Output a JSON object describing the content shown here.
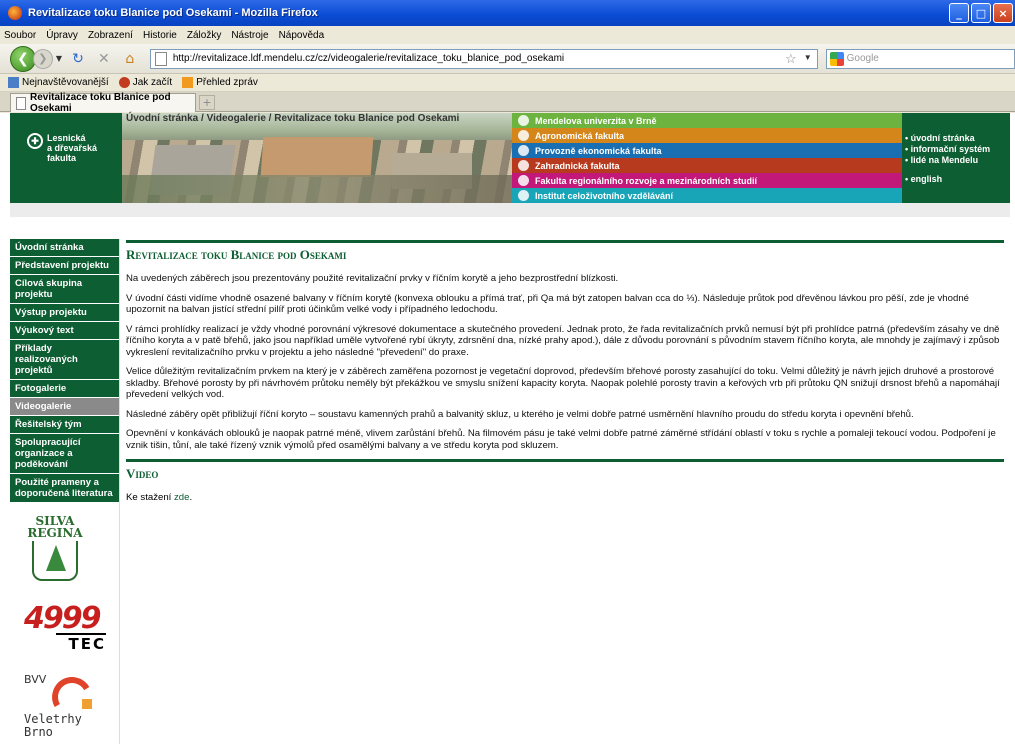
{
  "browser": {
    "title": "Revitalizace toku Blanice pod Osekami - Mozilla Firefox",
    "menu": [
      "Soubor",
      "Úpravy",
      "Zobrazení",
      "Historie",
      "Záložky",
      "Nástroje",
      "Nápověda"
    ],
    "url": "http://revitalizace.ldf.mendelu.cz/cz/videogalerie/revitalizace_toku_blanice_pod_osekami",
    "search_placeholder": "Google",
    "bookmarks": [
      "Nejnavštěvovanější",
      "Jak začít",
      "Přehled zpráv"
    ],
    "tab_label": "Revitalizace toku Blanice pod Osekami",
    "new_tab": "+"
  },
  "header": {
    "logo_lines": [
      "Lesnická",
      "a dřevařská",
      "fakulta"
    ],
    "faculties": [
      {
        "label": "Mendelova univerzita v Brně",
        "color": "#6db33f"
      },
      {
        "label": "Agronomická fakulta",
        "color": "#d4861a"
      },
      {
        "label": "Provozně ekonomická fakulta",
        "color": "#1a6fb3"
      },
      {
        "label": "Zahradnická fakulta",
        "color": "#b83a1e"
      },
      {
        "label": "Fakulta regionálního rozvoje a mezinárodních studií",
        "color": "#c2187a"
      },
      {
        "label": "Institut celoživotního vzdělávání",
        "color": "#19a5b8"
      }
    ],
    "links": [
      "• úvodní stránka",
      "• informační systém",
      "• lidé na Mendelu",
      "• english"
    ]
  },
  "breadcrumb": {
    "home": "Úvodní stránka",
    "sep": " / ",
    "section": "Videogalerie",
    "current": "Revitalizace toku Blanice pod Osekami"
  },
  "sidebar": {
    "items": [
      {
        "label": "Úvodní stránka",
        "active": false
      },
      {
        "label": "Představení projektu",
        "active": false
      },
      {
        "label": "Cílová skupina projektu",
        "active": false
      },
      {
        "label": "Výstup projektu",
        "active": false
      },
      {
        "label": "Výukový text",
        "active": false
      },
      {
        "label": "Příklady realizovaných projektů",
        "active": false
      },
      {
        "label": "Fotogalerie",
        "active": false
      },
      {
        "label": "Videogalerie",
        "active": true
      },
      {
        "label": "Řešitelský tým",
        "active": false
      },
      {
        "label": "Spolupracující organizace a poděkování",
        "active": false
      },
      {
        "label": "Použité prameny a doporučená literatura",
        "active": false
      }
    ],
    "logos": {
      "silva": [
        "SILVA",
        "REGINA"
      ],
      "htec_num": "4999",
      "htec_text": "TEC",
      "bvv_short": "BVV",
      "bvv_lines": [
        "Veletrhy",
        "Brno"
      ]
    }
  },
  "content": {
    "title": "Revitalizace toku Blanice pod Osekami",
    "paragraphs": [
      "Na uvedených záběrech jsou prezentovány použité revitalizační prvky v říčním korytě a jeho bezprostřední blízkosti.",
      "V úvodní části vidíme vhodně osazené balvany v říčním korytě (konvexa oblouku a přímá trať, při Qa má být zatopen balvan cca do ⅓). Následuje průtok pod dřevěnou lávkou pro pěší, zde je vhodné upozornit na balvan jistící střední pilíř proti účinkům velké vody i případného ledochodu.",
      "V rámci prohlídky realizací je vždy vhodné porovnání výkresové dokumentace a skutečného provedení. Jednak proto, že řada revitalizačních prvků nemusí být při prohlídce patrná (především zásahy ve dně říčního koryta a v patě břehů, jako jsou například uměle vytvořené rybí úkryty, zdrsnění dna, nízké prahy apod.), dále z důvodu porovnání s původním stavem říčního koryta, ale mnohdy je zajímavý i způsob vykreslení revitalizačního prvku v projektu a jeho následné \"převedení\" do praxe.",
      "Velice důležitým revitalizačním prvkem na který je v záběrech zaměřena pozornost je vegetační doprovod, především břehové porosty zasahující do toku. Velmi důležitý je návrh jejich druhové a prostorové skladby. Břehové porosty by při návrhovém průtoku neměly být překážkou ve smyslu snížení kapacity koryta. Naopak polehlé porosty travin a keřových vrb při průtoku QN snižují drsnost břehů a napomáhají převedení velkých vod.",
      "Následné záběry opět přibližují říční koryto – soustavu kamenných prahů a balvanitý skluz, u kterého je velmi dobře patrné usměrnění hlavního proudu do středu koryta i opevnění břehů.",
      "Opevnění v konkávách oblouků je naopak patrné méně, vlivem zarůstání břehů. Na filmovém pásu je také velmi dobře patrné záměrné střídání oblastí v toku s rychle a pomaleji tekoucí vodou. Podpoření je vznik tišin, tůní, ale také řízený vznik výmolů před osamělými balvany a ve středu koryta pod skluzem."
    ],
    "video_title": "Video",
    "download_prefix": "Ke stažení ",
    "download_link": "zde",
    "download_suffix": "."
  }
}
